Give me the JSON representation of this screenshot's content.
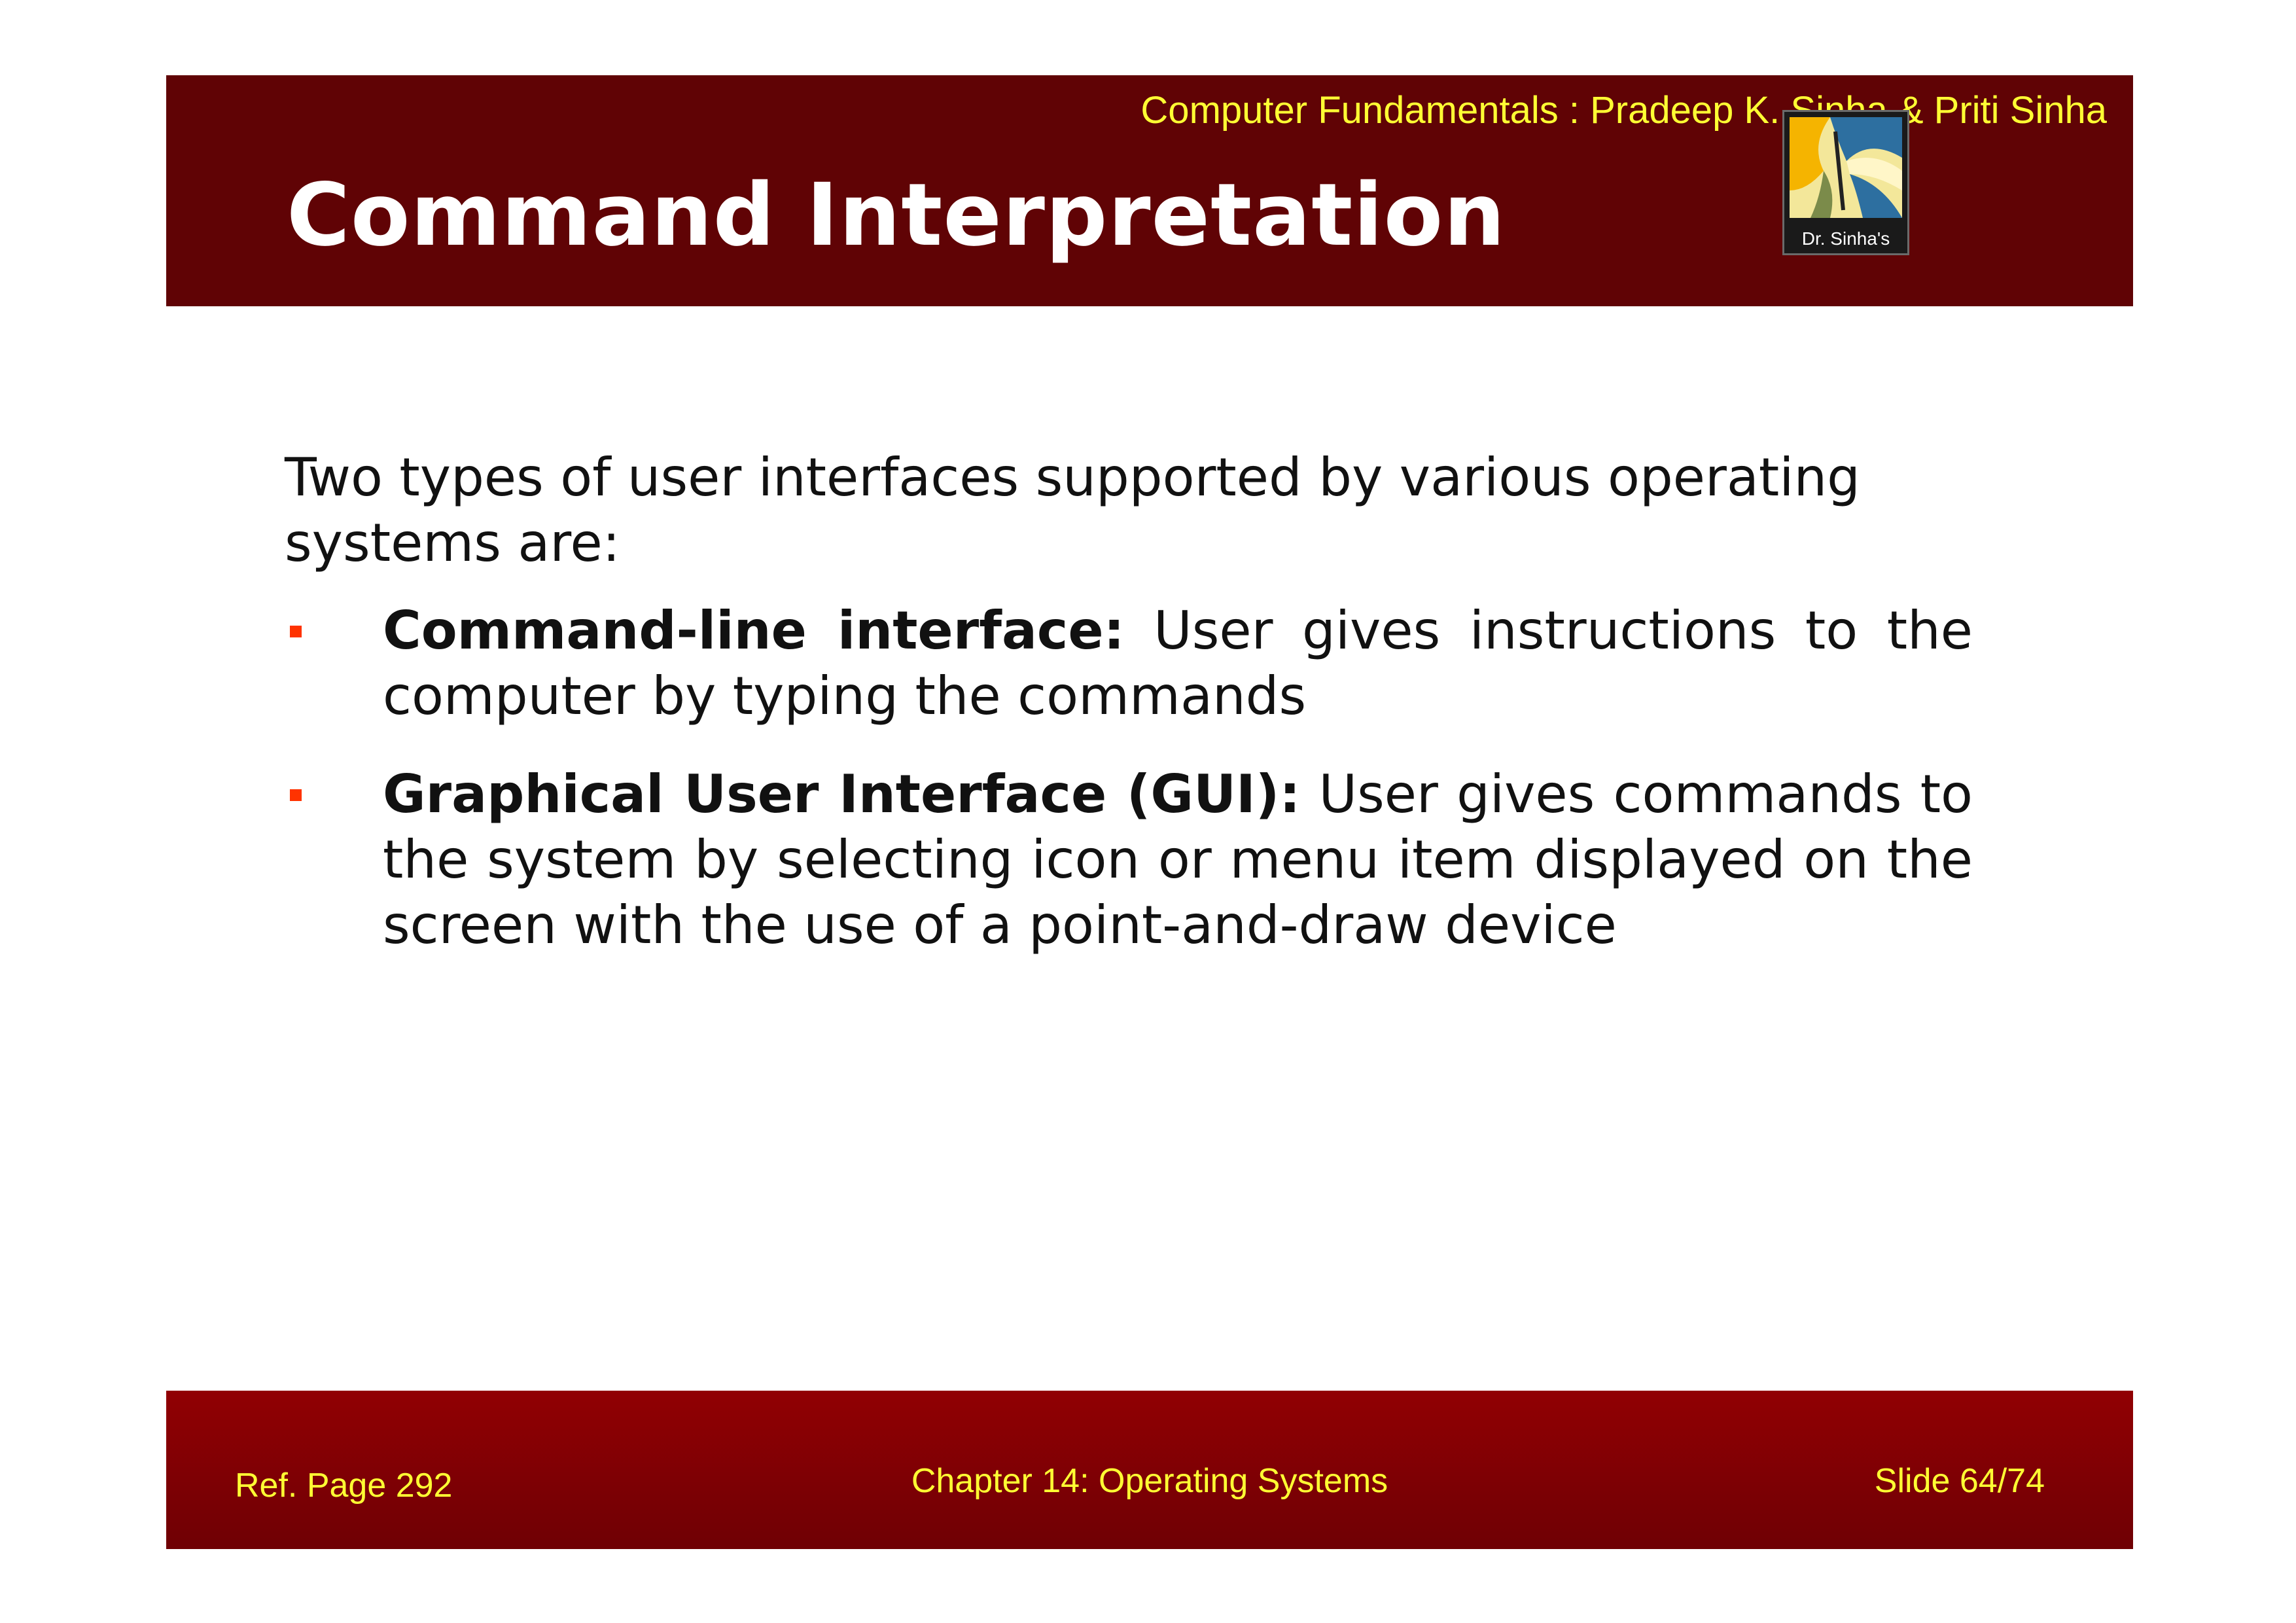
{
  "header": {
    "credit": "Computer Fundamentals : Pradeep K. Sinha & Priti Sinha",
    "title": "Command Interpretation",
    "logo_caption": "Dr. Sinha's"
  },
  "colors": {
    "header_bg": "#600305",
    "footer_bg": "#8a0003",
    "accent_text": "#ffff33",
    "bullet": "#ff3300"
  },
  "body": {
    "intro": "Two types of user interfaces supported by various operating systems are:",
    "bullets": [
      {
        "term": "Command-line interface:",
        "text": " User gives instructions to the computer by typing the commands"
      },
      {
        "term": "Graphical User Interface (GUI):",
        "text": " User gives commands to the system by selecting icon or menu item displayed on the screen with the use of a point-and-draw device"
      }
    ]
  },
  "footer": {
    "ref_page": "Ref. Page  292",
    "chapter": "Chapter 14: Operating Systems",
    "slide": "Slide 64/74"
  }
}
